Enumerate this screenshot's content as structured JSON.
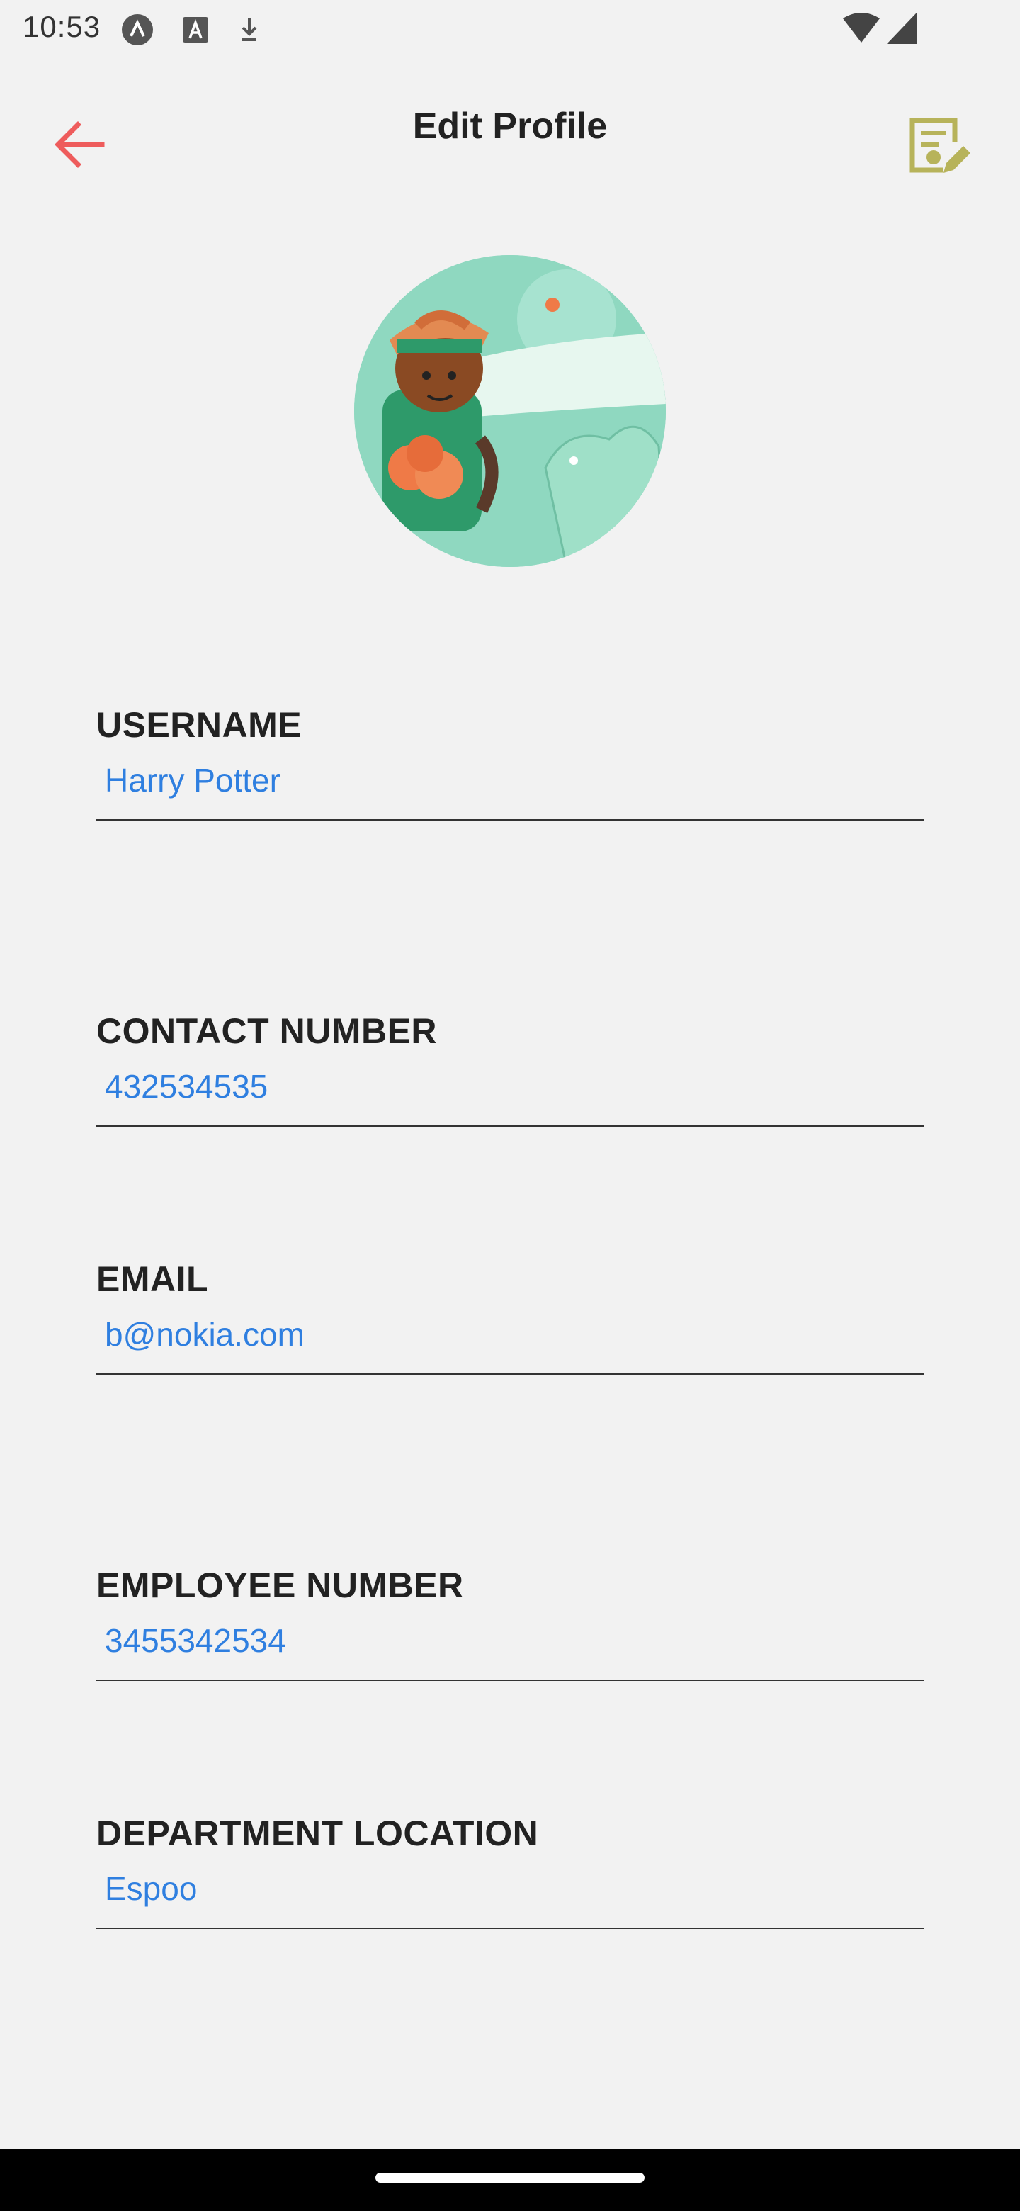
{
  "status_bar": {
    "time": "10:53",
    "icons": [
      "a-badge-icon",
      "text-a-icon",
      "download-icon",
      "wifi-icon",
      "cellular-signal-icon"
    ]
  },
  "app_bar": {
    "title": "Edit Profile",
    "back_icon": "arrow-left-icon",
    "edit_icon": "edit-document-icon",
    "accent_back": "#ee5c5c",
    "accent_edit": "#b7b35a"
  },
  "avatar": {
    "label": "profile-avatar"
  },
  "fields": [
    {
      "label": "USERNAME",
      "value": "Harry Potter"
    },
    {
      "label": "CONTACT NUMBER",
      "value": "432534535"
    },
    {
      "label": "EMAIL",
      "value": "b@nokia.com"
    },
    {
      "label": "EMPLOYEE NUMBER",
      "value": "3455342534"
    },
    {
      "label": "DEPARTMENT LOCATION",
      "value": "Espoo"
    }
  ],
  "colors": {
    "background": "#f2f2f2",
    "value_text": "#2f7fe0",
    "label_text": "#222222"
  }
}
